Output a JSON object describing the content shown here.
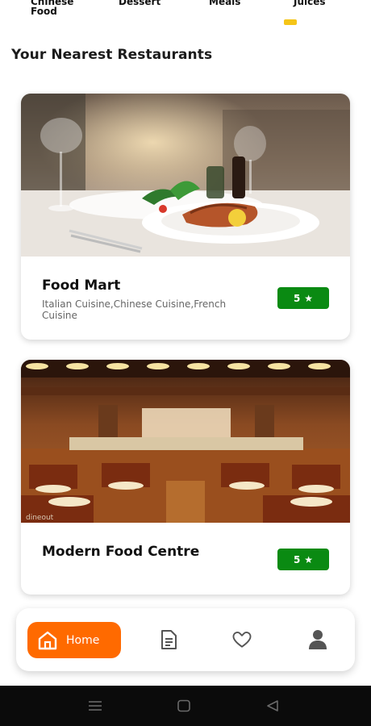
{
  "categories": [
    {
      "label": "Chinese\nFood"
    },
    {
      "label": "Dessert"
    },
    {
      "label": "Meals"
    },
    {
      "label": "Juices",
      "selected": true
    }
  ],
  "section_title": "Your Nearest Restaurants",
  "restaurants": [
    {
      "name": "Food Mart",
      "cuisine": "Italian Cuisine,Chinese Cuisine,French Cuisine",
      "rating": "5",
      "rating_icon": "star-icon",
      "image": "restaurant-dish-photo"
    },
    {
      "name": "Modern Food Centre",
      "cuisine": "",
      "rating": "5",
      "rating_icon": "star-icon",
      "image": "restaurant-interior-photo",
      "watermark": "dineout"
    }
  ],
  "bottom_nav": {
    "items": [
      {
        "label": "Home",
        "icon": "home-icon",
        "active": true
      },
      {
        "label": "",
        "icon": "orders-icon"
      },
      {
        "label": "",
        "icon": "heart-icon"
      },
      {
        "label": "",
        "icon": "profile-icon"
      }
    ]
  },
  "colors": {
    "accent": "#ff6a00",
    "rating_green": "#0a8a12",
    "category_indicator": "#f5c518"
  },
  "system_nav": [
    "menu-icon",
    "home-square-icon",
    "back-triangle-icon"
  ]
}
